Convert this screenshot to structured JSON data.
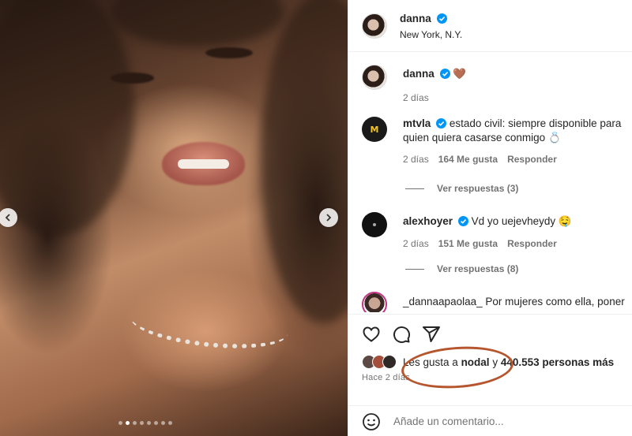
{
  "post": {
    "carousel_dots": 8,
    "active_dot": 1
  },
  "header": {
    "username": "danna",
    "location": "New York, N.Y."
  },
  "caption": {
    "username": "danna",
    "text": "🤎",
    "time": "2 días"
  },
  "comments": [
    {
      "username": "mtvla",
      "text": "estado civil: siempre disponible para quien quiera casarse conmigo 💍",
      "time": "2 días",
      "likes": "164 Me gusta",
      "reply": "Responder",
      "view_replies": "Ver respuestas (3)"
    },
    {
      "username": "alexhoyer",
      "text": "Vd yo uejevheydy 🤤",
      "time": "2 días",
      "likes": "151 Me gusta",
      "reply": "Responder",
      "view_replies": "Ver respuestas (8)"
    },
    {
      "username": "_dannaapaolaa_",
      "text": "Por mujeres como ella, poner"
    }
  ],
  "likes": {
    "prefix": "Les gusta a ",
    "user": "nodal",
    "middle": " y ",
    "count": "440.553 personas más"
  },
  "post_time": "Hace 2 días",
  "add_comment": {
    "placeholder": "Añade un comentario..."
  },
  "colors": {
    "verified": "#0095f6",
    "annotation_circle": "#b5562e"
  }
}
